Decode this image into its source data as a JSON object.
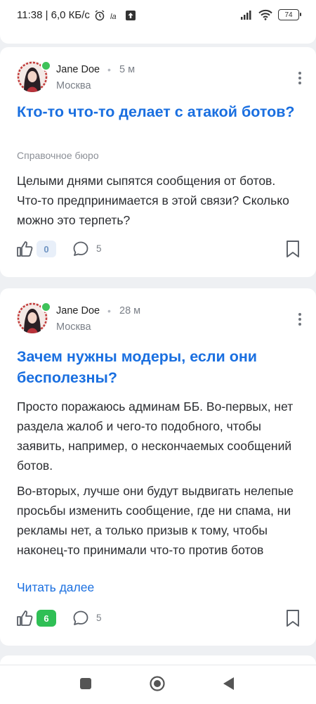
{
  "statusbar": {
    "time_speed": "11:38 | 6,0 КБ/с",
    "battery": "74"
  },
  "posts": [
    {
      "author": "Jane Doe",
      "time": "5 м",
      "location": "Москва",
      "title": "Кто-то что-то делает с атакой ботов?",
      "category": "Справочное бюро",
      "paragraphs": [
        "Целыми днями сыпятся сообщения от ботов. Что-то предпринимается в этой связи? Сколько можно это терпеть?"
      ],
      "likes": "0",
      "comments": "5"
    },
    {
      "author": "Jane Doe",
      "time": "28 м",
      "location": "Москва",
      "title": "Зачем нужны модеры, если они бесполезны?",
      "paragraphs": [
        "Просто поражаюсь админам ББ. Во-первых, нет раздела жалоб и чего-то подобного, чтобы заявить, например, о нескончаемых сообщений ботов.",
        "Во-вторых, лучше они будут выдвигать нелепые просьбы изменить сообщение, где ни спама, ни рекламы нет, а только призыв к тому, чтобы наконец-то принимали что-то против ботов"
      ],
      "read_more": "Читать далее",
      "likes": "6",
      "comments": "5"
    }
  ],
  "colors": {
    "accent": "#1a6fe0",
    "online": "#3fc25a",
    "like_active_bg": "#2fbf55"
  }
}
